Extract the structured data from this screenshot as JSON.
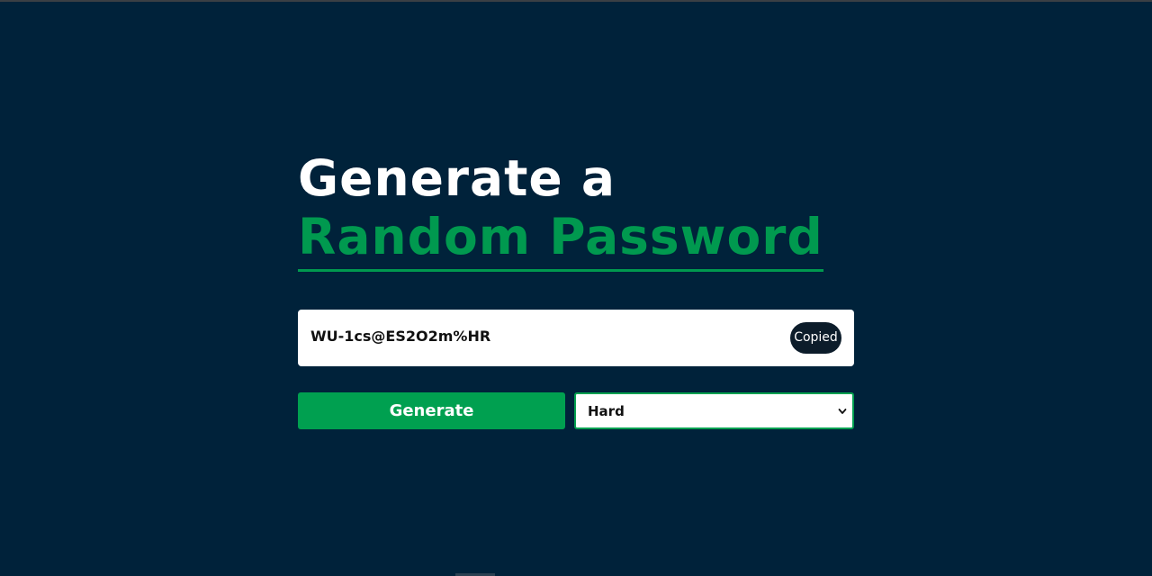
{
  "header": {
    "title_line1": "Generate a",
    "title_line2": "Random Password"
  },
  "password": {
    "value": "WU-1cs@ES2O2m%HR",
    "copy_label": "Copied"
  },
  "controls": {
    "generate_label": "Generate",
    "difficulty_selected": "Hard"
  },
  "colors": {
    "background": "#00223a",
    "accent": "#00a050",
    "title_accent": "#00994f"
  },
  "icons": {
    "dropdown": "chevron-down-icon"
  }
}
